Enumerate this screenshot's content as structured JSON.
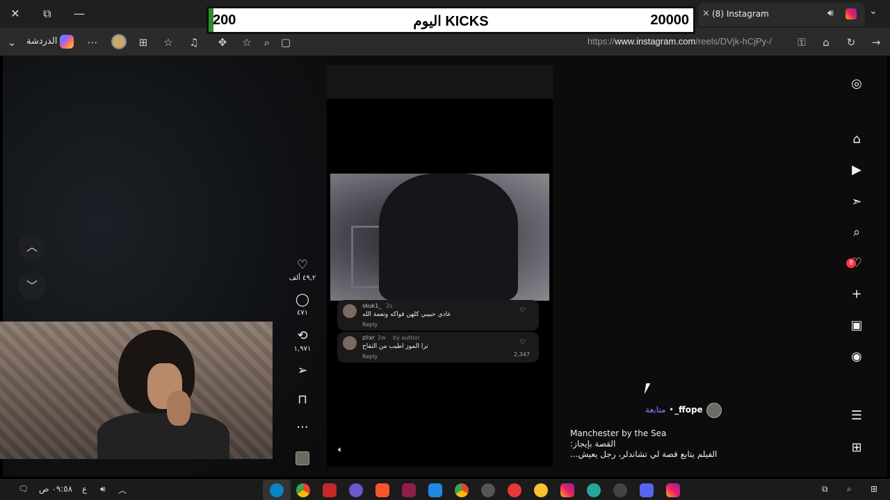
{
  "browser": {
    "tab_title": "(8) Instagram",
    "tab_close": "×",
    "chat_label": "الدردشة",
    "url_prefix": "https://",
    "url_host": "www.instagram.com",
    "url_path": "/reels/DVjk-hCjPy-/"
  },
  "ticker": {
    "current": "200",
    "label": "KICKS اليوم",
    "goal": "20000",
    "progress": 0.01
  },
  "post": {
    "likes": "٤٩,٢ ألف",
    "comments": "٤٧١",
    "reposts": "١,٩٧١",
    "handle": "_ffope",
    "separator": "•",
    "follow_label": "متابعة",
    "caption_line1": "Manchester by the Sea",
    "caption_line2": "القصة بإيجاز:",
    "caption_line3": "الفيلم يتابع قصة لي تشاندلر، رجل يعيش..."
  },
  "comments": [
    {
      "user": "skuk1_",
      "time": "2s",
      "text": "عادي حبيبي كلهن فواكه ونعمة الله",
      "reply": "Reply",
      "likes": ""
    },
    {
      "user": "zi!xr",
      "time": "2w",
      "by": "by author",
      "text": "ترا الموز اطيب من التفاح",
      "reply": "Reply",
      "likes": "2,347"
    }
  ],
  "right_nav": {
    "messages_badge": "8"
  },
  "taskbar": {
    "time": "٠٩:٥٨ ص",
    "lang": "ع"
  },
  "colors": {
    "follow": "#7b8cff",
    "progress": "#2e8b2e",
    "badge": "#ff3040"
  },
  "icons": [
    "instagram-icon",
    "home-icon",
    "reels-icon",
    "direct-icon",
    "search-icon",
    "heart-icon",
    "plus-icon",
    "dashboard-icon",
    "profile-icon",
    "menu-icon",
    "more-apps-icon"
  ]
}
